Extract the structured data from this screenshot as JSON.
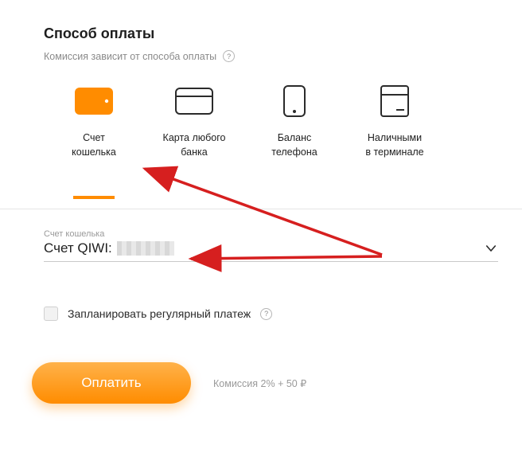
{
  "header": {
    "title": "Способ оплаты",
    "commission_note": "Комиссия зависит от способа оплаты"
  },
  "methods": [
    {
      "id": "wallet",
      "label": "Счет\nкошелька"
    },
    {
      "id": "card",
      "label": "Карта любого\nбанка"
    },
    {
      "id": "phone",
      "label": "Баланс\nтелефона"
    },
    {
      "id": "terminal",
      "label": "Наличными\nв терминале"
    }
  ],
  "account": {
    "label": "Счет кошелька",
    "value": "Счет QIWI:"
  },
  "schedule": {
    "label": "Запланировать регулярный платеж"
  },
  "pay": {
    "button": "Оплатить",
    "fee_note": "Комиссия 2% + 50 ₽"
  }
}
